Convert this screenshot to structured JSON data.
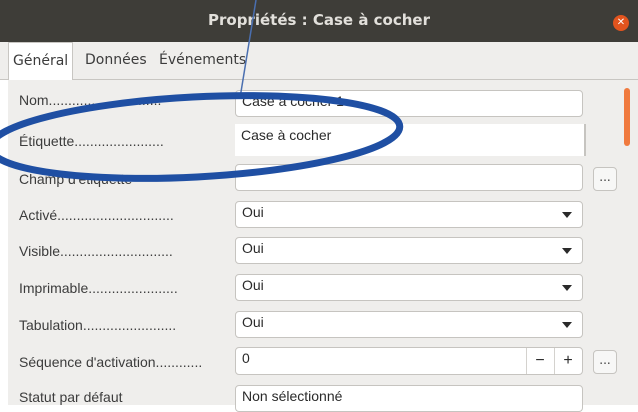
{
  "window": {
    "title": "Propriétés : Case à cocher",
    "close_label": "✕"
  },
  "tabs": [
    {
      "label": "Général",
      "active": true
    },
    {
      "label": "Données",
      "active": false
    },
    {
      "label": "Événements",
      "active": false
    }
  ],
  "rows": {
    "nom": {
      "label": "Nom.............................",
      "value": "Case à cocher 1"
    },
    "etiquette": {
      "label": "Étiquette.......................",
      "value": "Case à cocher"
    },
    "champ": {
      "label": "Champ d'étiquette",
      "value": "",
      "button": "..."
    },
    "active": {
      "label": "Activé..............................",
      "value": "Oui"
    },
    "visible": {
      "label": "Visible.............................",
      "value": "Oui"
    },
    "imprimable": {
      "label": "Imprimable.......................",
      "value": "Oui"
    },
    "tabulation": {
      "label": "Tabulation........................",
      "value": "Oui"
    },
    "sequence": {
      "label": "Séquence d'activation............",
      "value": "0",
      "minus": "−",
      "plus": "+",
      "button": "..."
    },
    "statut": {
      "label": "Statut par défaut",
      "value": "Non sélectionné"
    }
  },
  "annotation": {
    "shape": "ellipse",
    "color": "#1f4fa3"
  }
}
